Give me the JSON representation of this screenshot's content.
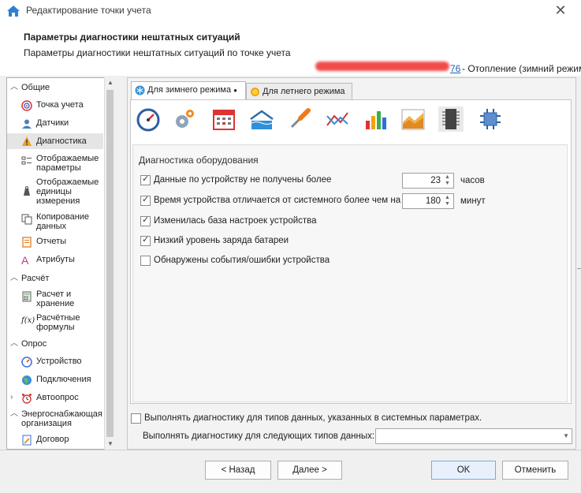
{
  "window": {
    "title": "Редактирование точки учета",
    "close_glyph": "✕"
  },
  "header": {
    "title": "Параметры диагностики нештатных ситуаций",
    "subtitle": "Параметры диагностики нештатных ситуаций по точке учета",
    "link_text": "76",
    "point_name": " - Отопление (зимний режим)"
  },
  "sidebar": {
    "groups": [
      {
        "label": "Общие",
        "expanded": true
      },
      {
        "label": "Расчёт",
        "expanded": true
      },
      {
        "label": "Опрос",
        "expanded": true
      },
      {
        "label": "Энергоснабжающая организация",
        "expanded": true
      }
    ],
    "items": [
      {
        "label": "Точка учета",
        "icon": "target-icon"
      },
      {
        "label": "Датчики",
        "icon": "sensor-person-icon"
      },
      {
        "label": "Диагностика",
        "icon": "warning-icon",
        "selected": true
      },
      {
        "label": "Отображаемые параметры",
        "icon": "checklist-icon"
      },
      {
        "label": "Отображаемые единицы измерения",
        "icon": "weight-icon"
      },
      {
        "label": "Копирование данных",
        "icon": "copy-icon"
      },
      {
        "label": "Отчеты",
        "icon": "report-icon"
      },
      {
        "label": "Атрибуты",
        "icon": "letter-a-icon"
      },
      {
        "label": "Расчет и хранение",
        "icon": "calculator-icon"
      },
      {
        "label": "Расчётные формулы",
        "icon": "formula-icon"
      },
      {
        "label": "Устройство",
        "icon": "gauge-icon"
      },
      {
        "label": "Подключения",
        "icon": "globe-icon"
      },
      {
        "label": "Автоопрос",
        "icon": "alarm-clock-icon"
      },
      {
        "label": "Договор",
        "icon": "contract-icon"
      }
    ]
  },
  "tabs": [
    {
      "label": "Для зимнего режима",
      "active": true,
      "modified_dot": "●",
      "icon": "snowflake-icon"
    },
    {
      "label": "Для летнего режима",
      "active": false,
      "icon": "sun-icon"
    }
  ],
  "tool_icons": [
    "speedometer-icon",
    "gears-icon",
    "calendar-icon",
    "water-level-icon",
    "screwdriver-icon",
    "line-chart-icon",
    "bar-chart-icon",
    "area-chart-icon",
    "chip-icon",
    "processor-icon"
  ],
  "diagnostics": {
    "group_title": "Диагностика оборудования",
    "rows": [
      {
        "label": "Данные по устройству не получены более",
        "checked": true,
        "value": "23",
        "unit": "часов"
      },
      {
        "label": "Время устройства отличается от системного более чем на",
        "checked": true,
        "value": "180",
        "unit": "минут"
      },
      {
        "label": "Изменилась база настроек устройства",
        "checked": true
      },
      {
        "label": "Низкий уровень заряда батареи",
        "checked": true
      },
      {
        "label": "Обнаружены события/ошибки устройства",
        "checked": false
      }
    ]
  },
  "footer_options": {
    "system_params": {
      "label": "Выполнять диагностику для типов данных, указанных в системных параметрах.",
      "checked": false
    },
    "custom_types_label": "Выполнять диагностику для следующих типов данных:",
    "custom_types_value": ""
  },
  "buttons": {
    "back": "< Назад",
    "next": "Далее >",
    "ok": "OK",
    "cancel": "Отменить"
  },
  "colors": {
    "accent": "#1a5fb4",
    "primary_button_border": "#7aa9df",
    "selected_bg": "#e5e5e5"
  }
}
